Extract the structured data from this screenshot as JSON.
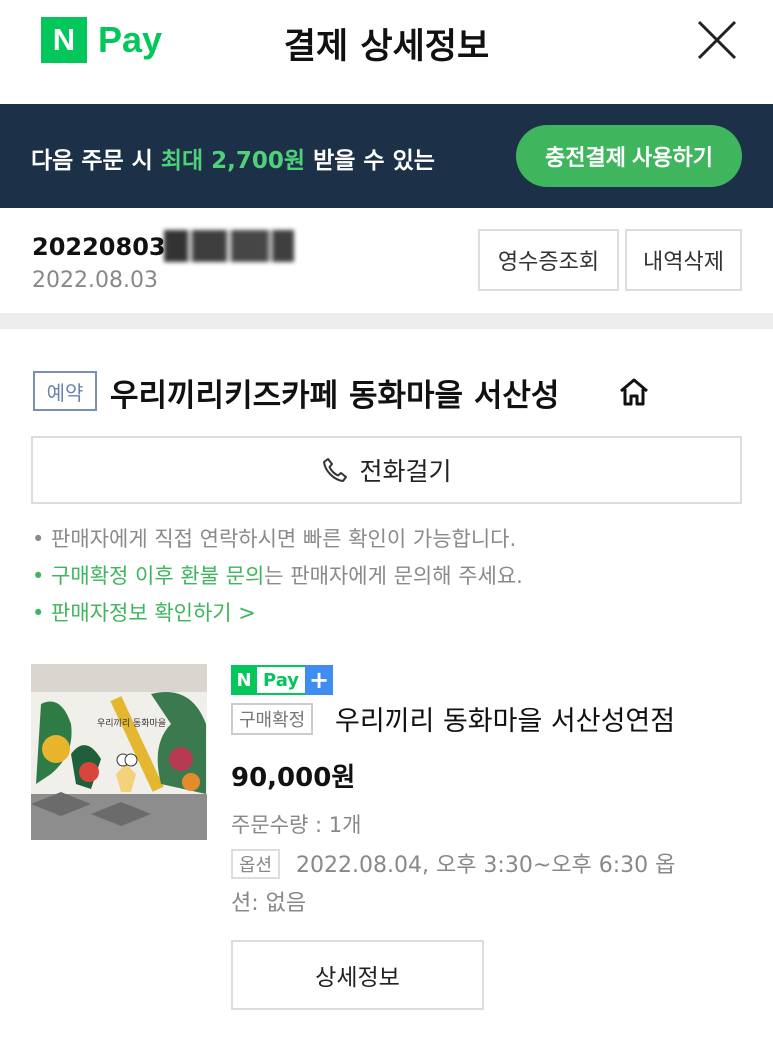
{
  "header": {
    "logo_n": "N",
    "logo_pay": "Pay",
    "title": "결제 상세정보",
    "close_icon": "close-icon"
  },
  "banner": {
    "text_before": "다음 주문 시 ",
    "text_highlight": "최대 2,700원",
    "text_after": " 받을 수 있는",
    "button_label": "충전결제 사용하기",
    "highlight_color": "#4fd17a",
    "background_color": "#1c3047"
  },
  "order": {
    "number_prefix": "20220803",
    "date": "2022.08.03",
    "receipt_button": "영수증조회",
    "delete_button": "내역삭제"
  },
  "store": {
    "badge": "예약",
    "name": "우리끼리키즈카페 동화마을 서산성",
    "home_icon": "home-icon",
    "call_button": "전화걸기",
    "call_icon": "phone-icon"
  },
  "notices": {
    "line1": "• 판매자에게 직접 연락하시면 빠른 확인이 가능합니다.",
    "line2_highlight": "• 구매확정 이후 환불 문의",
    "line2_rest": "는 판매자에게 문의해 주세요.",
    "line3": "• 판매자정보 확인하기 >"
  },
  "product": {
    "npay_n": "N",
    "npay_pay": "Pay",
    "npay_plus": "+",
    "status": "구매확정",
    "name": "우리끼리 동화마을 서산성연점",
    "price": "90,000원",
    "quantity": "주문수량 : 1개",
    "option_badge": "옵션",
    "option_line1": "2022.08.04, 오후 3:30~오후 6:30 옵",
    "option_line2": "션: 없음",
    "detail_button": "상세정보",
    "thumb_caption": "우리끼리 동화마을"
  }
}
